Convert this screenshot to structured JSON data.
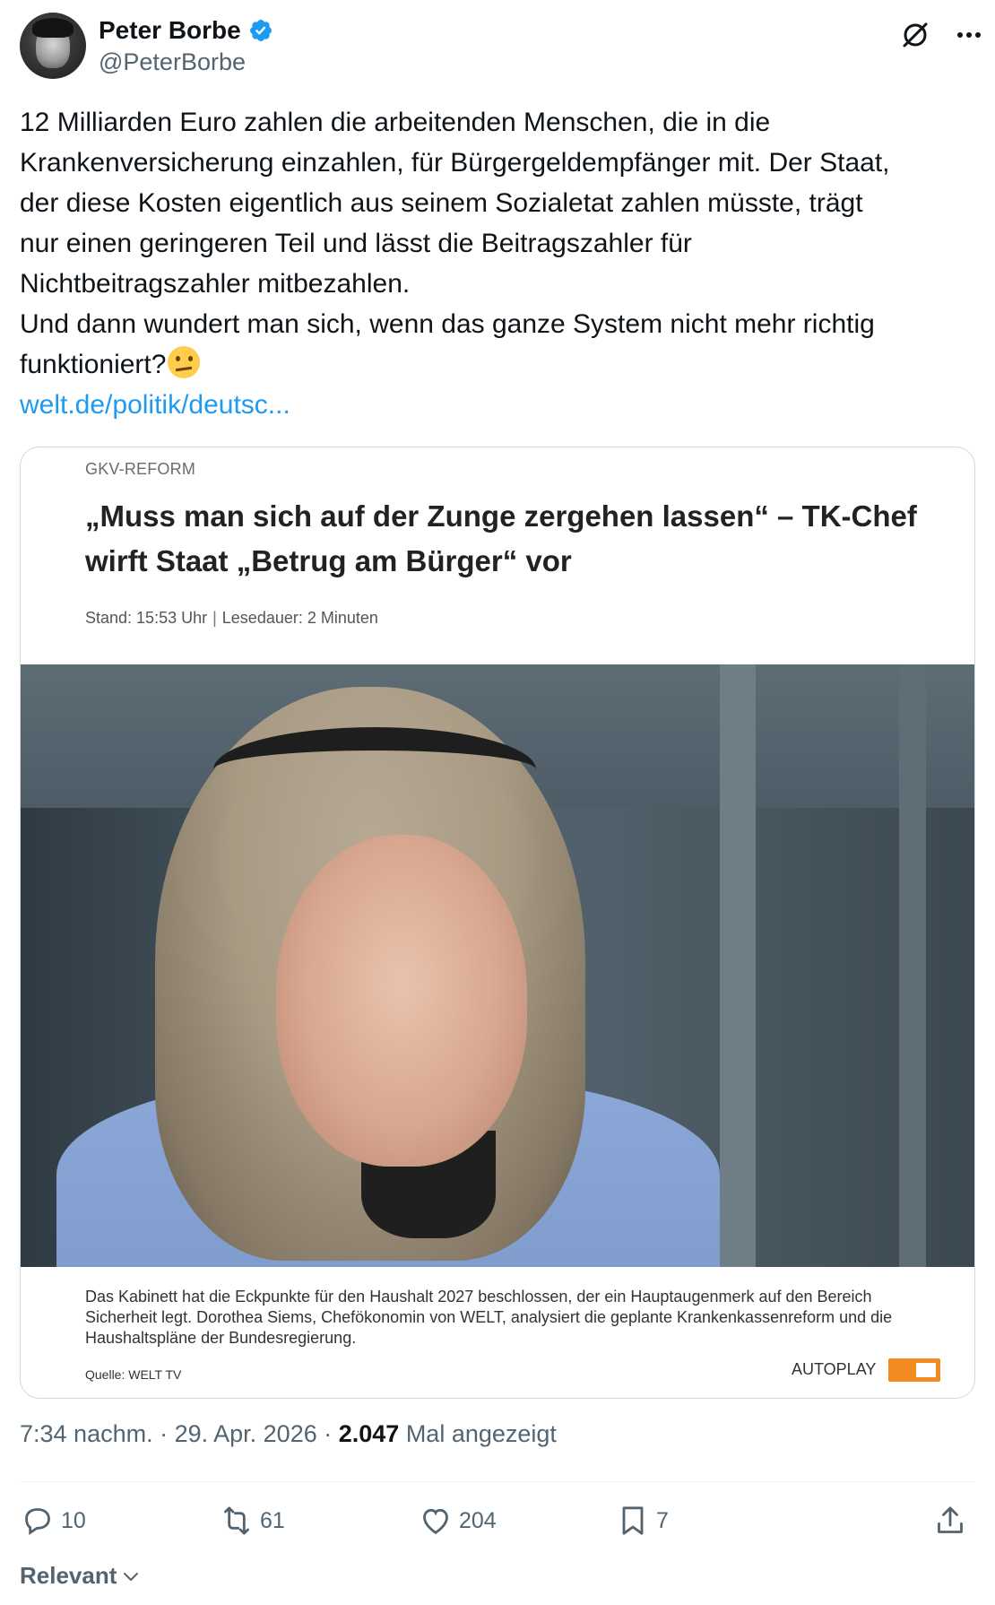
{
  "author": {
    "name": "Peter Borbe",
    "handle": "@PeterBorbe"
  },
  "tweet": {
    "lines": [
      "12 Milliarden Euro zahlen die arbeitenden Menschen, die in die",
      "Krankenversicherung einzahlen, für Bürgergeldempfänger mit. Der Staat,",
      "der diese Kosten eigentlich aus seinem Sozialetat zahlen müsste, trägt",
      "nur einen geringeren Teil und lässt die Beitragszahler für",
      "Nichtbeitragszahler mitbezahlen.",
      "Und dann wundert man sich, wenn das ganze System nicht mehr richtig",
      "funktioniert?"
    ],
    "emoji": "face-with-raised-eyebrow",
    "link": "welt.de/politik/deutsc..."
  },
  "card": {
    "kicker": "GKV-REFORM",
    "headline": "„Muss man sich auf der Zunge zergehen lassen“ – TK-Chef wirft Staat „Betrug am Bürger“ vor",
    "stand": "Stand: 15:53 Uhr",
    "separator": "|",
    "lesedauer": "Lesedauer: 2 Minuten",
    "caption": "Das Kabinett hat die Eckpunkte für den Haushalt 2027 beschlossen, der ein Hauptaugenmerk auf den Bereich Sicherheit legt. Dorothea Siems, Chefökonomin von WELT, analysiert die geplante Krankenkassenreform und die Haushaltspläne der Bundesregierung.",
    "source": "Quelle: WELT TV",
    "autoplay": "AUTOPLAY",
    "autoplay_on": true
  },
  "timestamp": {
    "time_date": "7:34 nachm. · 29. Apr. 2026 · ",
    "views": "2.047",
    "views_label": " Mal angezeigt"
  },
  "actions": {
    "replies": "10",
    "reposts": "61",
    "likes": "204",
    "bookmarks": "7"
  },
  "sort": {
    "label": "Relevant"
  },
  "colors": {
    "link": "#1d9bf0",
    "verified": "#1d9bf0",
    "secondary_text": "#536471",
    "autoplay_toggle": "#f18a1f"
  }
}
